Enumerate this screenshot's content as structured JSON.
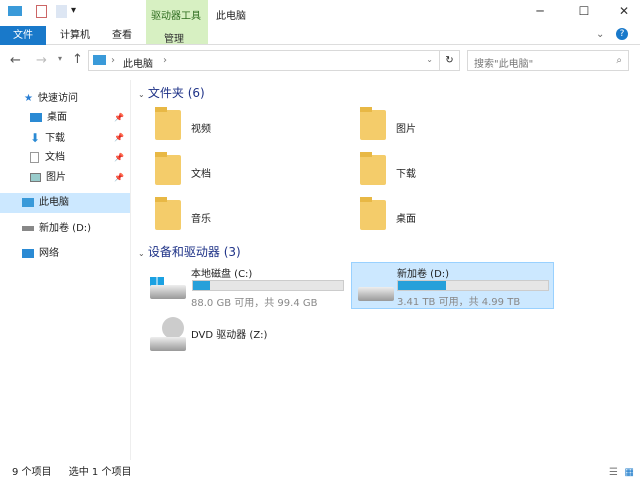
{
  "window": {
    "title": "此电脑",
    "context_tab": "驱动器工具",
    "context_subtab": "管理"
  },
  "ribbon_tabs": [
    "文件",
    "计算机",
    "查看"
  ],
  "address": {
    "path": "此电脑",
    "search_placeholder": "搜索\"此电脑\""
  },
  "sidebar": {
    "quick_access": "快速访问",
    "quick_items": [
      "桌面",
      "下载",
      "文档",
      "图片"
    ],
    "this_pc": "此电脑",
    "drive_d": "新加卷 (D:)",
    "network": "网络"
  },
  "folders_section": "文件夹 (6)",
  "folders": [
    "视频",
    "图片",
    "文档",
    "下载",
    "音乐",
    "桌面"
  ],
  "devices_section": "设备和驱动器 (3)",
  "drives": [
    {
      "name": "本地磁盘 (C:)",
      "info": "88.0 GB 可用，共 99.4 GB",
      "used_fraction": 0.115
    },
    {
      "name": "新加卷 (D:)",
      "info": "3.41 TB 可用，共 4.99 TB",
      "used_fraction": 0.317
    },
    {
      "name": "DVD 驱动器 (Z:)"
    }
  ],
  "status": {
    "count": "9 个项目",
    "selected": "选中 1 个项目"
  },
  "colors": {
    "accent": "#1979ca",
    "selection": "#cce8ff",
    "bar": "#26a0da"
  }
}
